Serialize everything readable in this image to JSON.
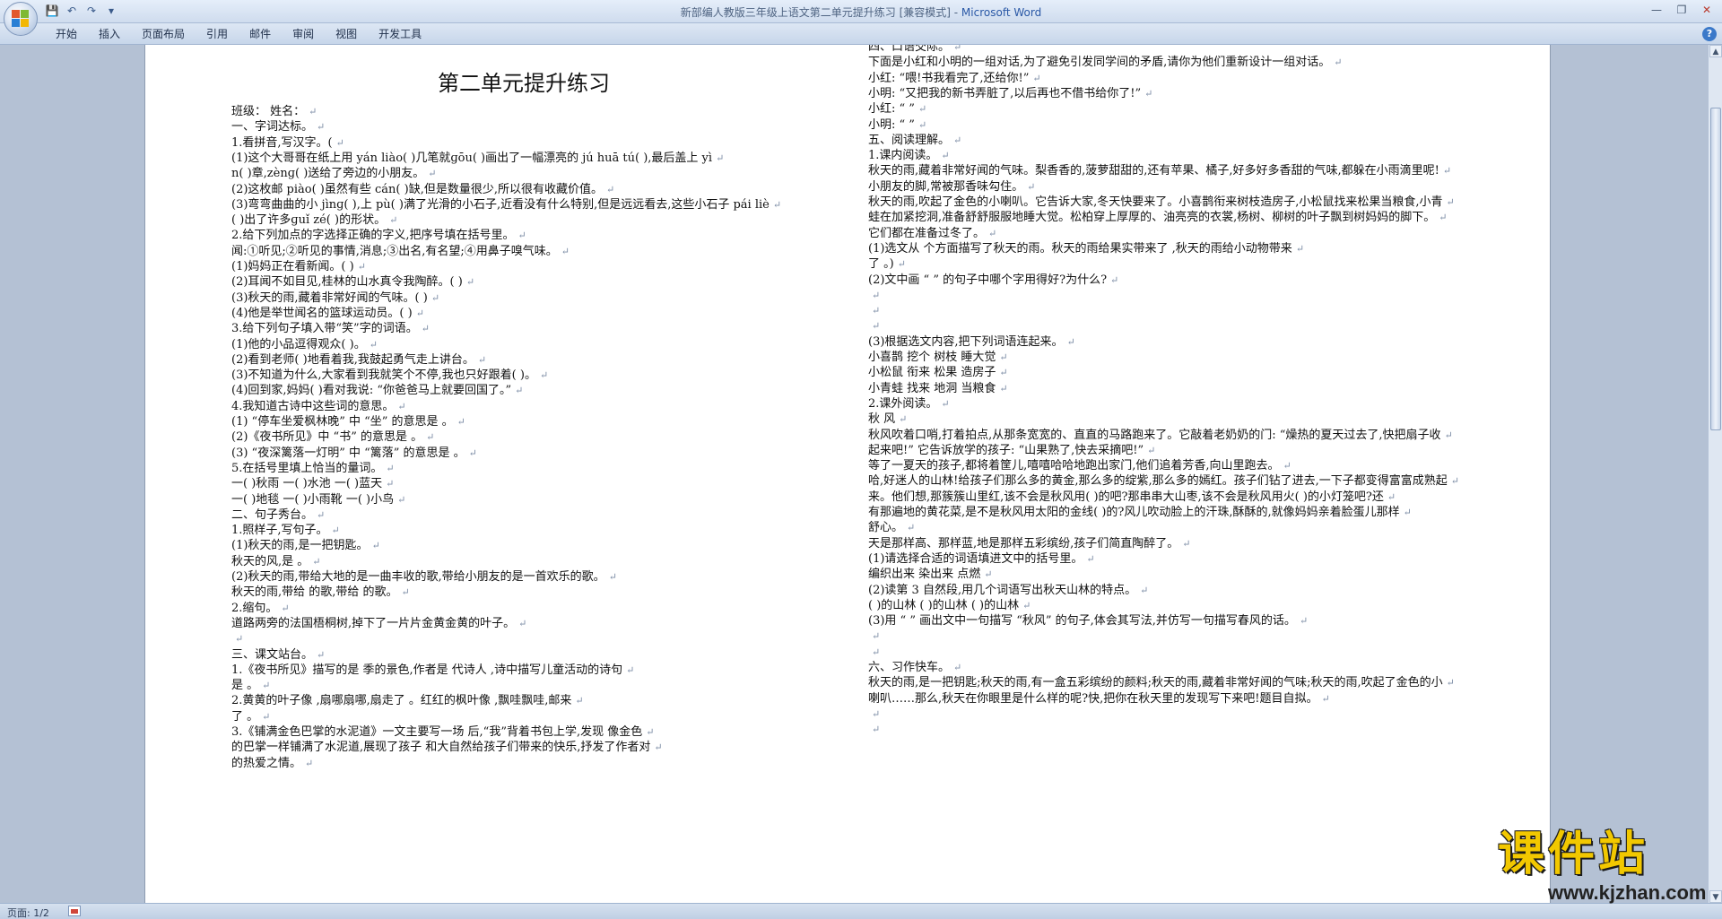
{
  "titlebar": {
    "doc_title": "新部编人教版三年级上语文第二单元提升练习 [兼容模式] - ",
    "app_name": "Microsoft Word",
    "qat": {
      "save": "💾",
      "undo": "↶",
      "redo": "↷",
      "customize": "▾"
    },
    "controls": {
      "minimize": "—",
      "maximize": "❐",
      "close": "✕"
    }
  },
  "ribbon": {
    "tabs": [
      "开始",
      "插入",
      "页面布局",
      "引用",
      "邮件",
      "审阅",
      "视图",
      "开发工具"
    ],
    "help": "?"
  },
  "document": {
    "title": "第二单元提升练习",
    "left_lines": [
      "班级：                      姓名：",
      "一、字词达标。",
      "1.看拼音,写汉字。(",
      "(1)这个大哥哥在纸上用  yán liào(          )几笔就ɡōu(       )画出了一幅漂亮的  jú  huā  tú(             ),最后盖上  yì",
      "n(       )章,zènɡ(       )送给了旁边的小朋友。",
      "(2)这枚邮 piào(       )虽然有些  cán(       )缺,但是数量很少,所以很有收藏价值。",
      "(3)弯弯曲曲的小  jìnɡ(       ),上  pù(       )满了光滑的小石子,近看没有什么特别,但是远远看去,这些小石子  pái  liè",
      "(          )出了许多ɡuǐ zé(         )的形状。",
      "2.给下列加点的字选择正确的字义,把序号填在括号里。",
      "闻:①听见;②听见的事情,消息;③出名,有名望;④用鼻子嗅气味。",
      "(1)妈妈正在看新闻。(       )",
      "(2)耳闻不如目见,桂林的山水真令我陶醉。(       )",
      "(3)秋天的雨,藏着非常好闻的气味。(       )",
      "(4)他是举世闻名的篮球运动员。(       )",
      "3.给下列句子填入带“笑”字的词语。",
      "(1)他的小品逗得观众(                  )。",
      "(2)看到老师(                  )地看着我,我鼓起勇气走上讲台。",
      "(3)不知道为什么,大家看到我就笑个不停,我也只好跟着(                  )。",
      "(4)回到家,妈妈(                  )看对我说: “你爸爸马上就要回国了。”",
      "4.我知道古诗中这些词的意思。",
      "(1) “停车坐爱枫林晚” 中 “坐” 的意思是                                。",
      "(2)《夜书所见》中 “书” 的意思是                         。",
      "(3) “夜深篱落一灯明” 中 “篱落” 的意思是                              。",
      "5.在括号里填上恰当的量词。",
      "一(       )秋雨        一(       )水池      一(       )蓝天",
      "一(       )地毯        一(       )小雨靴    一(       )小鸟",
      "二、句子秀台。",
      "1.照样子,写句子。",
      "(1)秋天的雨,是一把钥匙。",
      "秋天的风,是                                                                                             。",
      "(2)秋天的雨,带给大地的是一曲丰收的歌,带给小朋友的是一首欢乐的歌。",
      "秋天的雨,带给                            的歌,带给                            的歌。",
      "2.缩句。",
      "道路两旁的法国梧桐树,掉下了一片片金黄金黄的叶子。",
      "",
      "三、课文站台。",
      "1.《夜书所见》描写的是                季的景色,作者是            代诗人              ,诗中描写儿童活动的诗句",
      "是                                                                       。",
      "2.黄黄的叶子像                                  ,扇哪扇哪,扇走了                  。红红的枫叶像                          ,飘哇飘哇,邮来",
      "了                                  。",
      "3.《铺满金色巴掌的水泥道》一文主要写一场                          后,“我”背着书包上学,发现                          像金色",
      "的巴掌一样铺满了水泥道,展现了孩子                                  和大自然给孩子们带来的快乐,抒发了作者对",
      "的热爱之情。"
    ],
    "right_lines": [
      "四、口语交际。",
      "下面是小红和小明的一组对话,为了避免引发同学间的矛盾,请你为他们重新设计一组对话。",
      "小红: “喂!书我看完了,还给你!”",
      "小明: “又把我的新书弄脏了,以后再也不借书给你了!”",
      "小红: “                                                                                    ”",
      "小明: “                                                                                    ”",
      "五、阅读理解。",
      "1.课内阅读。",
      "秋天的雨,藏着非常好闻的气味。梨香香的,菠萝甜甜的,还有苹果、橘子,好多好多香甜的气味,都躲在小雨滴里呢!",
      "小朋友的脚,常被那香味勾住。",
      "秋天的雨,吹起了金色的小喇叭。它告诉大家,冬天快要来了。小喜鹊衔来树枝造房子,小松鼠找来松果当粮食,小青",
      "蛙在加紧挖洞,准备舒舒服服地睡大觉。松柏穿上厚厚的、油亮亮的衣裳,杨树、柳树的叶子飘到树妈妈的脚下。",
      "它们都在准备过冬了。",
      "(1)选文从               个方面描写了秋天的雨。秋天的雨给果实带来了                        ,秋天的雨给小动物带来",
      "了                                     。)",
      "(2)文中画 “        ” 的句子中哪个字用得好?为什么?",
      "",
      "",
      "",
      "(3)根据选文内容,把下列词语连起来。",
      "小喜鹊          挖个          树枝          睡大觉",
      "小松鼠          衔来          松果          造房子",
      "小青蛙          找来          地洞          当粮食",
      "2.课外阅读。",
      "秋      风",
      "秋风吹着口哨,打着拍点,从那条宽宽的、直直的马路跑来了。它敲着老奶奶的门: “燥热的夏天过去了,快把扇子收",
      "起来吧!” 它告诉放学的孩子: “山果熟了,快去采摘吧!”",
      "等了一夏天的孩子,都将着筐儿,嘻嘻哈哈地跑出家门,他们追着芳香,向山里跑去。",
      "哈,好迷人的山林!给孩子们那么多的黄金,那么多的绽紫,那么多的嫣红。孩子们钻了进去,一下子都变得富富成熟起",
      "来。他们想,那簇簇山里红,该不会是秋风用(            )的吧?那串串大山枣,该不会是秋风用火(            )的小灯笼吧?还",
      "有那遍地的黄花菜,是不是秋风用太阳的金线(            )的?风儿吹动脸上的汗珠,酥酥的,就像妈妈亲着脸蛋儿那样",
      "舒心。",
      "天是那样高、那样蓝,地是那样五彩缤纷,孩子们简直陶醉了。",
      "(1)请选择合适的词语填进文中的括号里。",
      "编织出来    染出来     点燃",
      "(2)读第 3 自然段,用几个词语写出秋天山林的特点。",
      "(          )的山林         (          )的山林         (          )的山林",
      "(3)用 “        ” 画出文中一句描写 “秋风” 的句子,体会其写法,并仿写一句描写春风的话。",
      "",
      "",
      "六、习作快车。",
      "秋天的雨,是一把钥匙;秋天的雨,有一盒五彩缤纷的颜料;秋天的雨,藏着非常好闻的气味;秋天的雨,吹起了金色的小",
      "喇叭……那么,秋天在你眼里是什么样的呢?快,把你在秋天里的发现写下来吧!题目自拟。",
      "",
      ""
    ],
    "para_mark": "↵"
  },
  "statusbar": {
    "pages": "页面: 1/2"
  },
  "watermark": {
    "title": "课件站",
    "url": "www.kjzhan.com"
  },
  "colors": {
    "title_accent": "#2a58a6",
    "watermark_yellow": "#f2c800",
    "page_bg": "#ffffff",
    "frame_bg": "#b4c1d4"
  }
}
